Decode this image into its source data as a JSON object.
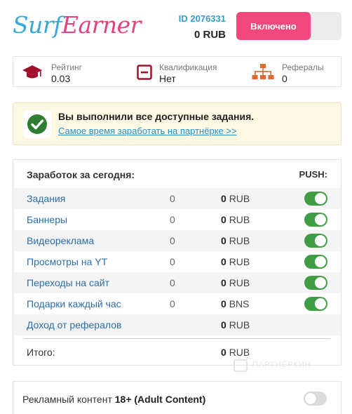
{
  "header": {
    "logo_part1": "Surf",
    "logo_part2": "Earner",
    "account_id": "ID 2076331",
    "balance": "0 RUB",
    "toggle_label": "Включено"
  },
  "stats": {
    "rating": {
      "label": "Рейтинг",
      "value": "0.03",
      "icon": "graduation-cap-icon"
    },
    "qualification": {
      "label": "Квалификация",
      "value": "Нет",
      "icon": "minus-box-icon"
    },
    "referrals": {
      "label": "Рефералы",
      "value": "0",
      "icon": "org-chart-icon"
    }
  },
  "alert": {
    "message": "Вы выполнили все доступные задания.",
    "link": "Самое время заработать на партнёрке >>",
    "icon": "check-circle-icon"
  },
  "earnings": {
    "title": "Заработок за сегодня:",
    "push_label": "PUSH:",
    "rows": [
      {
        "name": "Задания",
        "count": "0",
        "amount": "0",
        "currency": "RUB",
        "push": true
      },
      {
        "name": "Баннеры",
        "count": "0",
        "amount": "0",
        "currency": "RUB",
        "push": true
      },
      {
        "name": "Видеореклама",
        "count": "0",
        "amount": "0",
        "currency": "RUB",
        "push": true
      },
      {
        "name": "Просмотры на YT",
        "count": "0",
        "amount": "0",
        "currency": "RUB",
        "push": true
      },
      {
        "name": "Переходы на сайт",
        "count": "0",
        "amount": "0",
        "currency": "RUB",
        "push": true
      },
      {
        "name": "Подарки каждый час",
        "count": "0",
        "amount": "0",
        "currency": "BNS",
        "push": true
      },
      {
        "name": "Доход от рефералов",
        "count": "",
        "amount": "0",
        "currency": "RUB",
        "push": false
      }
    ],
    "total": {
      "label": "Итого:",
      "amount": "0",
      "currency": "RUB"
    }
  },
  "watermark": "ПАРТНЁРКИН",
  "adult": {
    "label_prefix": "Рекламный контент",
    "label_bold": "18+ (Adult Content)",
    "enabled": false
  },
  "colors": {
    "brand_blue": "#35a8d6",
    "brand_pink": "#e6407e",
    "toggle_on": "#3f9e45",
    "link": "#2a8fc9"
  }
}
